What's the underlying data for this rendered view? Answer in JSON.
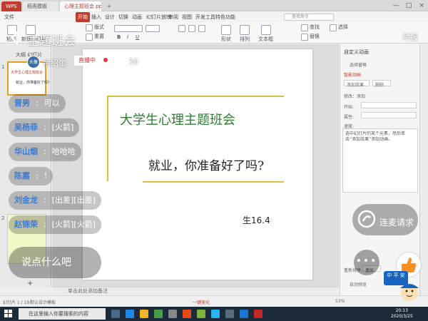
{
  "window": {
    "tabs": [
      "WPS",
      "稻壳模板",
      "心理主题班会.ppt"
    ],
    "add_tab": "+",
    "buttons": {
      "minimize": "—",
      "maximize": "□",
      "close": "×"
    }
  },
  "menu": {
    "items": [
      "文件",
      "开始",
      "插入",
      "设计",
      "切换",
      "动画",
      "幻灯片放映",
      "审阅",
      "视图",
      "开发工具",
      "特色功能"
    ],
    "active_index": 1,
    "search_placeholder": "查找命令"
  },
  "ribbon": {
    "labels": [
      "粘贴",
      "新建幻灯片",
      "版式",
      "重置",
      "形状",
      "排列",
      "文本框",
      "查找",
      "替换",
      "选择"
    ]
  },
  "thumbnails": {
    "tabs": "大纲   幻灯片",
    "slide1": {
      "number": "1",
      "line1": "大学生心理主题班会",
      "line2": "就业，你准备好了吗？"
    },
    "slide2": {
      "number": "2"
    },
    "add": "+"
  },
  "slide": {
    "title": "大学生心理主题班会",
    "subtitle": "就业，你准备好了吗?",
    "number": "生16.4"
  },
  "notes": {
    "placeholder": "单击此处添加备注"
  },
  "taskpane": {
    "header": "自定义动画",
    "select_pane": "选择窗格",
    "add_effect": "添加效果",
    "smart_anim": "智能动画",
    "delete": "删除",
    "modify_label": "修改：添加",
    "start_label": "开始:",
    "property_label": "属性:",
    "speed_label": "速度:",
    "hint": "选中幻灯片的某个元素，然后单击“添加效果”添加动画。",
    "reorder_label": "重新排序",
    "play_button": "播放",
    "preview_label": "自动预览"
  },
  "statusbar": {
    "slide_count": "幻灯片 1 / 19",
    "theme": "默认设计模板",
    "beautify": "一键美化",
    "zoom": "53%"
  },
  "taskbar": {
    "search_placeholder": "在这里输入你要搜索的内容",
    "time": "20:13",
    "date": "2020/3/25"
  },
  "live": {
    "room_title": "主题班会",
    "report": "举报",
    "host_avatar_text": "头像",
    "host_name": "余绍奎",
    "status_badge": "直播中",
    "viewer_count": "30",
    "connect": "连麦请求",
    "say_placeholder": "说点什么吧",
    "more": "•••",
    "mascot_text": "中 平 安"
  },
  "chat": [
    {
      "name": "晋男",
      "text": "可以"
    },
    {
      "name": "吴杨菲",
      "text": "[火箭]"
    },
    {
      "name": "华山烟",
      "text": "哈哈哈"
    },
    {
      "name": "陈嘉",
      "text": "!"
    },
    {
      "name": "刘金龙",
      "text": "[出差][出差]"
    },
    {
      "name": "赵锦荣",
      "text": "[火箭][火箭]"
    }
  ],
  "colors": {
    "wps_red": "#c43a2c",
    "slide_title_green": "#2e7d32",
    "slide_accent_gold": "#d8c040",
    "chat_name_blue": "#3d7bd0",
    "live_red": "#e53935"
  }
}
